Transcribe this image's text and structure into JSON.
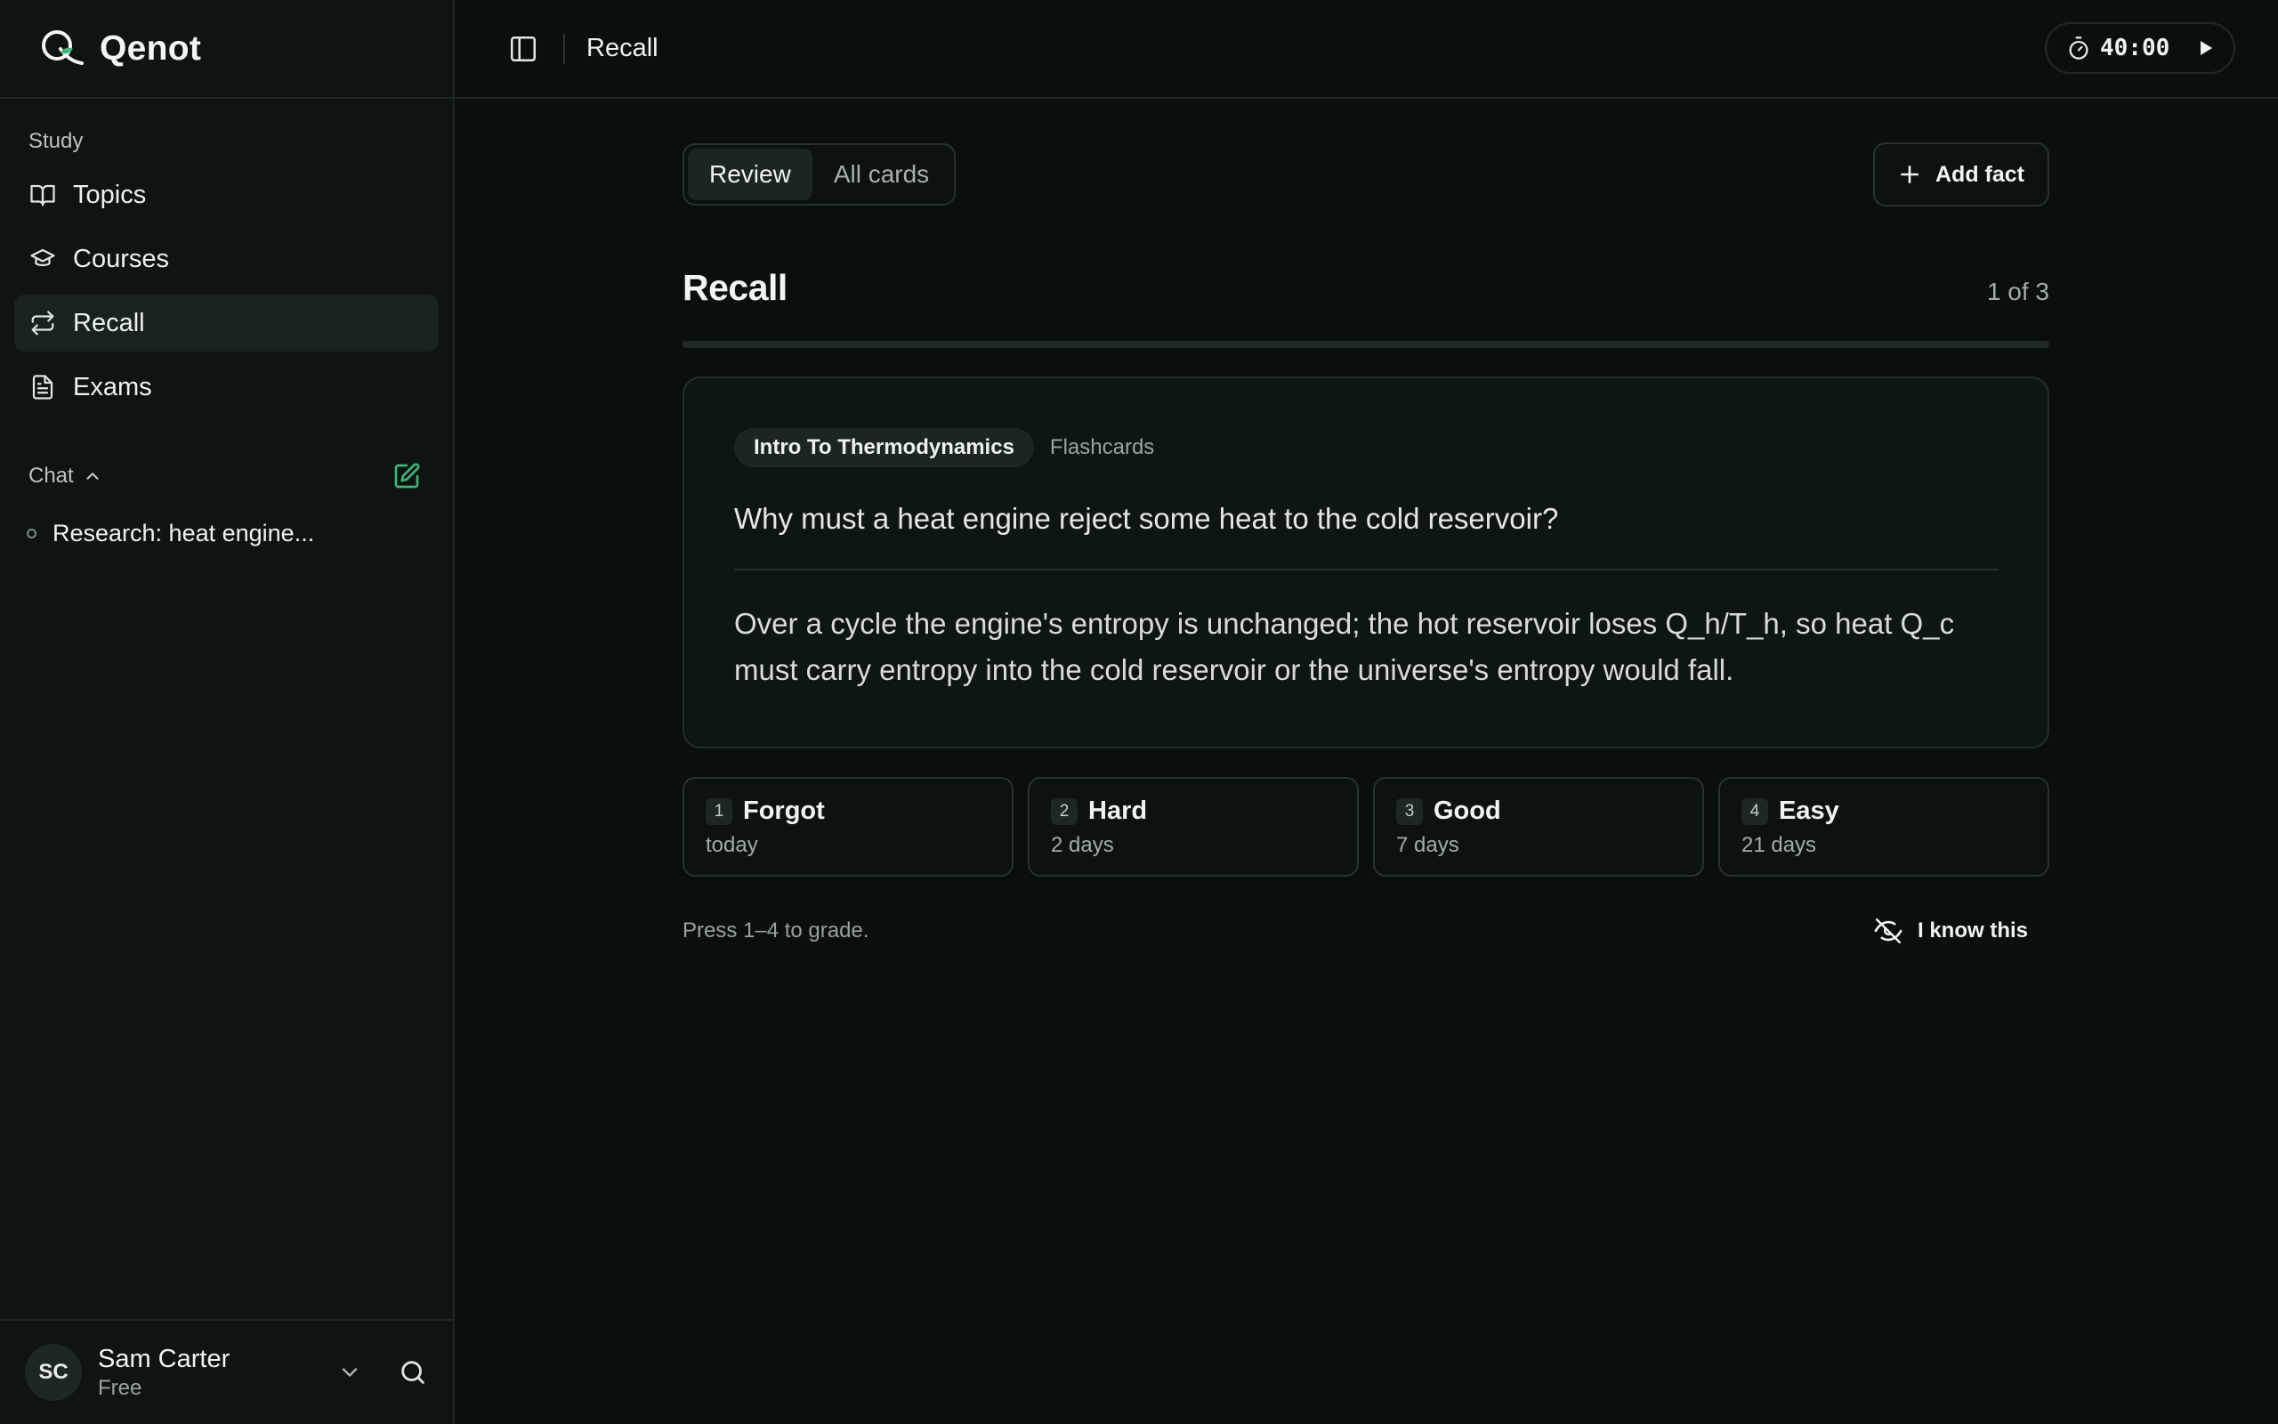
{
  "brand": {
    "name": "Qenot",
    "accent": "#3fb57a"
  },
  "sidebar": {
    "study_label": "Study",
    "items": [
      {
        "label": "Topics",
        "icon": "book-open-icon",
        "active": false
      },
      {
        "label": "Courses",
        "icon": "graduation-cap-icon",
        "active": false
      },
      {
        "label": "Recall",
        "icon": "repeat-icon",
        "active": true
      },
      {
        "label": "Exams",
        "icon": "file-text-icon",
        "active": false
      }
    ],
    "chat_label": "Chat",
    "chats": [
      {
        "title": "Research: heat engine..."
      }
    ]
  },
  "user": {
    "initials": "SC",
    "name": "Sam Carter",
    "plan": "Free"
  },
  "topbar": {
    "title": "Recall",
    "timer": "40:00"
  },
  "tabs": {
    "review": "Review",
    "all_cards": "All cards",
    "active": "review"
  },
  "actions": {
    "add_fact": "Add fact",
    "i_know_this": "I know this"
  },
  "recall": {
    "heading": "Recall",
    "counter": "1 of 3",
    "progress": 0.0
  },
  "card": {
    "topic": "Intro To Thermodynamics",
    "type": "Flashcards",
    "question": "Why must a heat engine reject some heat to the cold reservoir?",
    "answer": "Over a cycle the engine's entropy is unchanged; the hot reservoir loses Q_h/T_h, so heat Q_c must carry entropy into the cold reservoir or the universe's entropy would fall."
  },
  "grades": [
    {
      "key": "1",
      "label": "Forgot",
      "interval": "today"
    },
    {
      "key": "2",
      "label": "Hard",
      "interval": "2 days"
    },
    {
      "key": "3",
      "label": "Good",
      "interval": "7 days"
    },
    {
      "key": "4",
      "label": "Easy",
      "interval": "21 days"
    }
  ],
  "hint": "Press 1–4 to grade."
}
